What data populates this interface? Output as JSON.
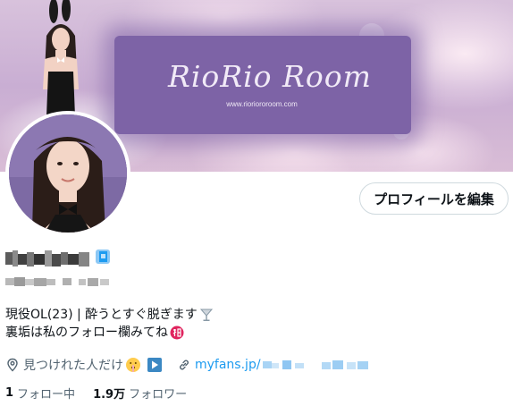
{
  "banner": {
    "title": "RioRio Room",
    "url": "www.rioriororoom.com"
  },
  "profile": {
    "edit_button_label": "プロフィールを編集",
    "bio_line1": "現役OL(23) | 酔うとすぐ脱ぎます",
    "bio_line2": "裏垢は私のフォロー欄みてね",
    "location": "見つけれた人だけ",
    "link": "myfans.jp/",
    "following_count": "1",
    "following_label": "フォロー中",
    "followers_count": "1.9万",
    "followers_label": "フォロワー"
  },
  "icons": {
    "location": "location-pin-icon",
    "link": "link-icon",
    "verified": "verified-badge-icon",
    "cocktail": "cocktail-glass-icon",
    "secret": "secret-ideograph-icon",
    "shush": "shushing-face-icon",
    "play": "play-button-icon"
  },
  "colors": {
    "accent": "#1d9bf0",
    "banner_panel": "#7d63a6",
    "secret_badge": "#e0245e"
  }
}
